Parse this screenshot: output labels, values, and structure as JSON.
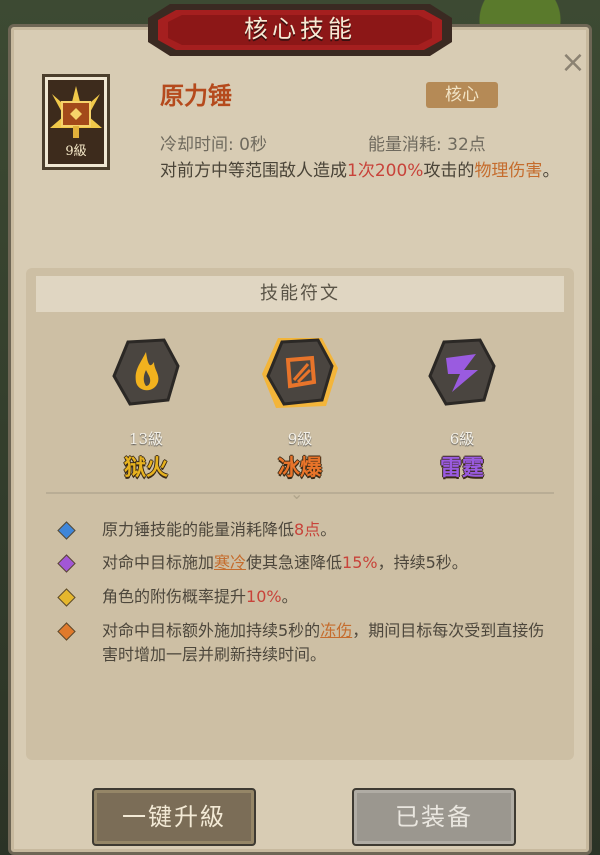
{
  "header": {
    "title": "核心技能",
    "close_symbol": "×"
  },
  "skill": {
    "icon": "hammer-icon",
    "level": "9級",
    "name": "原力锤",
    "tag": "核心",
    "cooldown": "冷却时间: 0秒",
    "energy": "能量消耗: 32点",
    "desc_part1": "对前方中等范围敌人造成",
    "desc_hit": "1次",
    "desc_percent": "200%",
    "desc_part2": "攻击的",
    "desc_type": "物理伤害",
    "desc_end": "。"
  },
  "runes": {
    "header": "技能符文",
    "items": [
      {
        "level": "13級",
        "name": "狱火",
        "icon": "fire-rune-icon",
        "color": "#e7b21f"
      },
      {
        "level": "9級",
        "name": "冰爆",
        "icon": "ice-burst-rune-icon",
        "color": "#e8742a",
        "selected": true
      },
      {
        "level": "6級",
        "name": "雷霆",
        "icon": "thunder-rune-icon",
        "color": "#9a5be0"
      }
    ]
  },
  "effects": [
    {
      "bullet_color": "#3f86d9",
      "parts": [
        "原力锤技能的能量消耗降低",
        "8点",
        "。"
      ]
    },
    {
      "bullet_color": "#a257d6",
      "parts": [
        "对命中目标施加",
        "寒冷",
        "使其急速降低",
        "15%",
        "，持续5秒。"
      ]
    },
    {
      "bullet_color": "#e5b72d",
      "parts": [
        "角色的附伤概率提升",
        "10%",
        "。"
      ]
    },
    {
      "bullet_color": "#e07a2c",
      "parts": [
        "对命中目标额外施加持续5秒的",
        "冻伤",
        "，期间目标每次受到直接伤害时增加一层并刷新持续时间。"
      ]
    }
  ],
  "buttons": {
    "upgrade": "一键升級",
    "equipped": "已装备"
  }
}
